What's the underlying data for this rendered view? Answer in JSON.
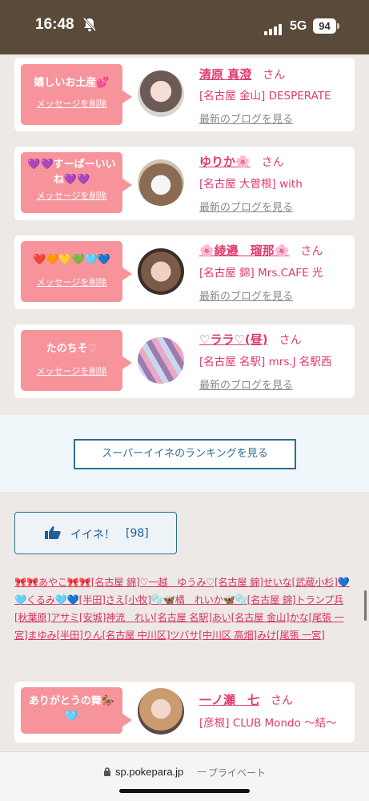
{
  "status": {
    "time": "16:48",
    "network": "5G",
    "battery": "94"
  },
  "cards": [
    {
      "message": "嬉しいお土産💕",
      "delete_label": "メッセージを削除",
      "name": "清原 真澄",
      "san": "さん",
      "shop": "[名古屋 金山] DESPERATE",
      "blog": "最新のブログを見る"
    },
    {
      "message": "💜💜すーぱーいいね💜💜",
      "delete_label": "メッセージを削除",
      "name": "ゆりか🌸",
      "san": "さん",
      "shop": "[名古屋 大曽根] with",
      "blog": "最新のブログを見る"
    },
    {
      "message": "❤️🧡💛💚🩵💙",
      "delete_label": "メッセージを削除",
      "name": "🌸綾邉　瑠那🌸",
      "san": "さん",
      "shop": "[名古屋 錦] Mrs.CAFE 光",
      "blog": "最新のブログを見る"
    },
    {
      "message": "たのちそ♡",
      "delete_label": "メッセージを削除",
      "name": "♡ララ♡(昼)",
      "san": "さん",
      "shop": "[名古屋 名駅] mrs.J 名駅西",
      "blog": "最新のブログを見る"
    },
    {
      "message": "ありがとうの舞🏇🩵",
      "delete_label": "",
      "name": "一ノ瀬　七",
      "san": "さん",
      "shop": "[彦根] CLUB Mondo 〜結〜",
      "blog": ""
    }
  ],
  "ranking_button": "スーパーイイネのランキングを見る",
  "iine": {
    "label": "イイネ！",
    "count": "[98]"
  },
  "likers_text": "🎀🎀あやこ🎀🎀[名古屋 錦]♡一越　ゆうみ♡[名古屋 錦]せいな[武蔵小杉]💙🩵くるみ🩵💙[半田]さえ[小牧]🫧🦋橘　れいか🦋🫧[名古屋 錦]トランプ兵[秋葉原]アサミ[安城]神流　れい[名古屋 名駅]あい[名古屋 金山]かな[尾張 一宮]まゆみ[半田]りん[名古屋 中川区]ツバサ[中川区 高畑]みけ[尾張 一宮]",
  "url": {
    "domain": "sp.pokepara.jp",
    "separator": "—",
    "mode": "プライベート"
  }
}
